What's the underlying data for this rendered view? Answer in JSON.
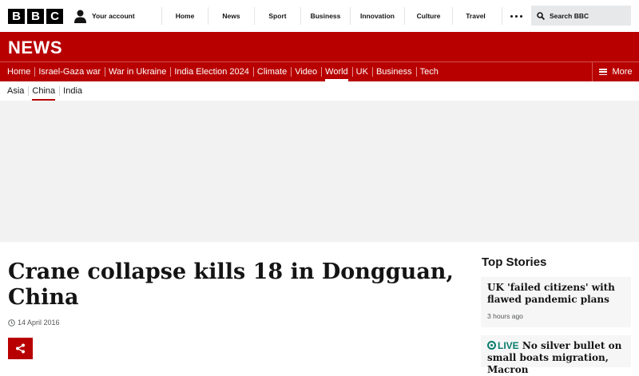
{
  "brand": {
    "logo_letters": [
      "B",
      "B",
      "C"
    ]
  },
  "account": {
    "label": "Your account",
    "icon": "person-icon"
  },
  "global_nav": [
    {
      "label": "Home"
    },
    {
      "label": "News"
    },
    {
      "label": "Sport"
    },
    {
      "label": "Business"
    },
    {
      "label": "Innovation"
    },
    {
      "label": "Culture"
    },
    {
      "label": "Travel"
    }
  ],
  "more_icon": "more-dots-icon",
  "search": {
    "label": "Search BBC",
    "icon": "search-icon"
  },
  "masthead": {
    "title": "NEWS"
  },
  "section_nav": [
    {
      "label": "Home"
    },
    {
      "label": "Israel-Gaza war"
    },
    {
      "label": "War in Ukraine"
    },
    {
      "label": "India Election 2024"
    },
    {
      "label": "Climate"
    },
    {
      "label": "Video"
    },
    {
      "label": "World",
      "active": true
    },
    {
      "label": "UK"
    },
    {
      "label": "Business"
    },
    {
      "label": "Tech"
    }
  ],
  "section_more": {
    "label": "More",
    "icon": "hamburger-icon"
  },
  "sub_nav": [
    {
      "label": "Asia"
    },
    {
      "label": "China",
      "active": true
    },
    {
      "label": "India"
    }
  ],
  "article": {
    "headline": "Crane collapse kills 18 in Dongguan, China",
    "date": "14 April 2016",
    "share_icon": "share-icon"
  },
  "top_stories": {
    "title": "Top Stories",
    "items": [
      {
        "headline": "UK 'failed citizens' with flawed pandemic plans",
        "time": "3 hours ago"
      },
      {
        "live": "LIVE",
        "headline": "No silver bullet on small boats migration, Macron"
      }
    ]
  },
  "colors": {
    "brand_red": "#b80000",
    "live_green": "#0a7d6e",
    "ad_grey": "#f2f2f2"
  }
}
